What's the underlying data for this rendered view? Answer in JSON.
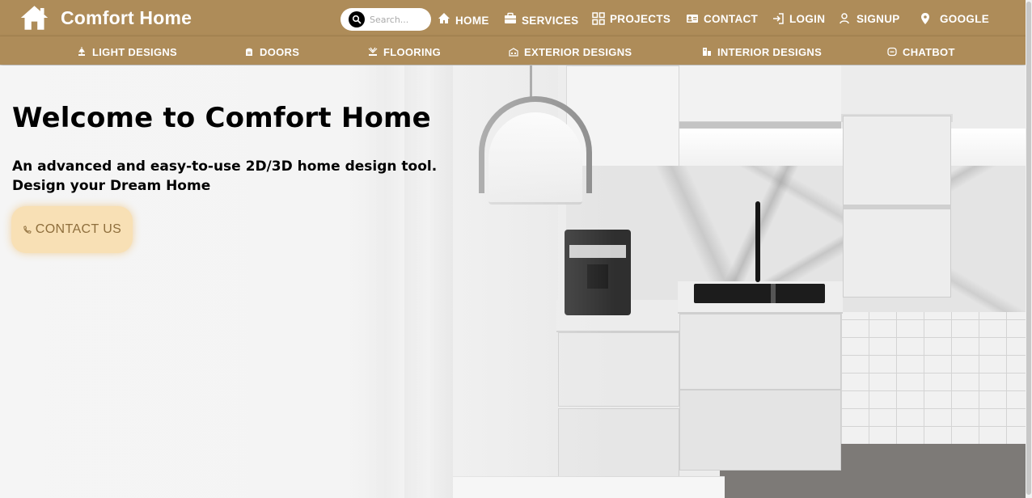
{
  "brand": {
    "name": "Comfort Home"
  },
  "search": {
    "placeholder": "Search..."
  },
  "nav": {
    "home": "HOME",
    "services": "SERVICES",
    "projects": "PROJECTS",
    "contact": "CONTACT",
    "login": "LOGIN",
    "signup": "SIGNUP",
    "google": "GOOGLE"
  },
  "subnav": {
    "light": "LIGHT DESIGNS",
    "doors": "DOORS",
    "flooring": "FLOORING",
    "exterior": "EXTERIOR DESIGNS",
    "interior": "INTERIOR DESIGNS",
    "chatbot": "CHATBOT"
  },
  "hero": {
    "title": "Welcome to Comfort Home",
    "subtitle_line1": "An advanced and easy-to-use 2D/3D home design tool.",
    "subtitle_line2": "Design your Dream Home",
    "cta": "CONTACT US"
  },
  "colors": {
    "header_bg": "#ae8c59",
    "cta_bg": "#f8e0b5",
    "cta_text": "#8e6e3c"
  }
}
